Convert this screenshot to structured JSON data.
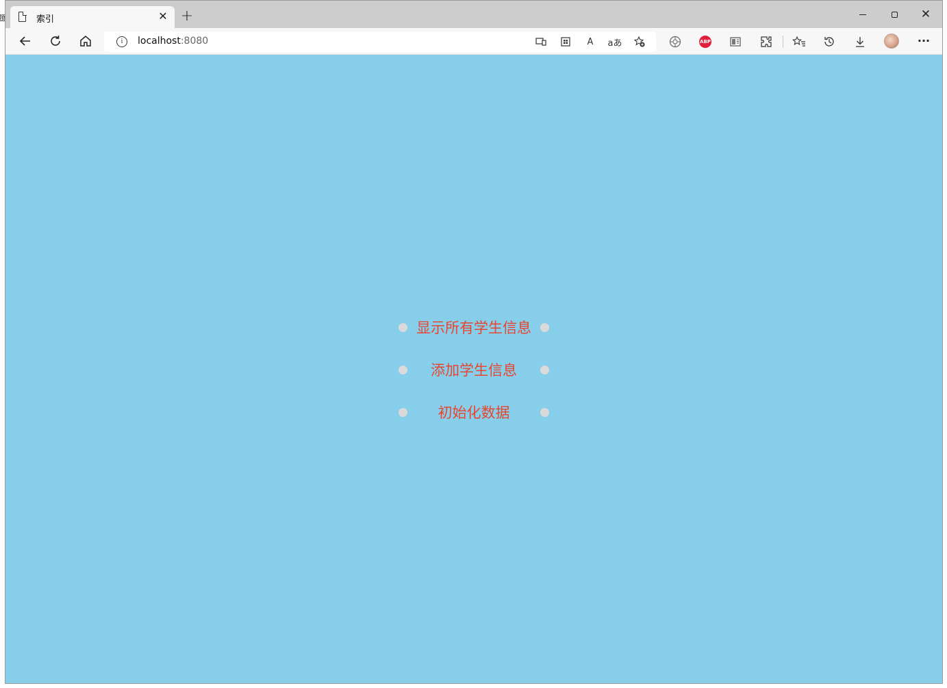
{
  "tab": {
    "title": "索引",
    "close": "✕"
  },
  "newtab": "+",
  "window_controls": {
    "close": "✕"
  },
  "left_sliver_glyph": "题",
  "address_bar": {
    "host": "localhost",
    "port": ":8080",
    "info": "i"
  },
  "toolbar_icons": [
    "device-icon",
    "apps-icon",
    "read-aloud-icon",
    "translate-icon",
    "add-favorite-icon",
    "extension-icon",
    "adblock-plus-icon",
    "reader-icon",
    "extensions-icon",
    "favorites-icon",
    "history-icon",
    "download-icon",
    "profile-avatar",
    "more-icon"
  ],
  "toolbar_text": {
    "read_aloud": "A",
    "translate": "aあ",
    "abp": "ABP",
    "more": "···"
  },
  "page": {
    "background": "#87ceeb",
    "link_color": "#e8452f",
    "menu": [
      {
        "label": "显示所有学生信息"
      },
      {
        "label": "添加学生信息"
      },
      {
        "label": "初始化数据"
      }
    ]
  }
}
